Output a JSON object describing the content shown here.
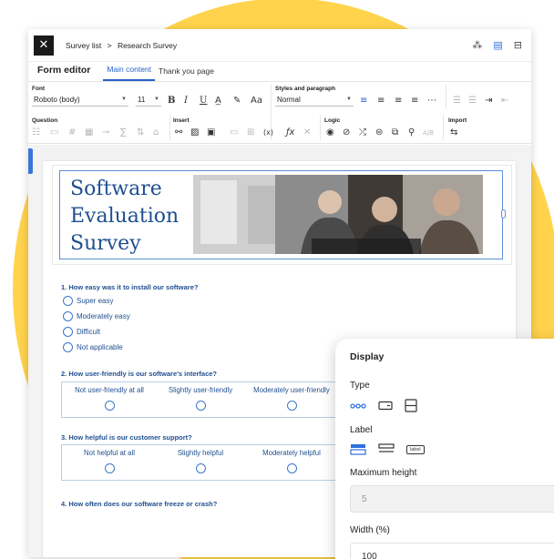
{
  "app": {
    "breadcrumb": {
      "parent": "Survey list",
      "separator": ">",
      "current": "Research Survey"
    },
    "top_icons": [
      "people-icon",
      "document-icon",
      "inbox-icon"
    ]
  },
  "tabs": {
    "title": "Form editor",
    "items": [
      "Main content",
      "Thank you page"
    ],
    "active": "Main content"
  },
  "ribbon": {
    "font_label": "Font",
    "font_value": "Roboto (body)",
    "font_size": "11",
    "case_label": "Aa",
    "styles_label": "Styles and paragraph",
    "style_value": "Normal",
    "question_label": "Question",
    "insert_label": "Insert",
    "logic_label": "Logic",
    "import_label": "Import",
    "more_label": "⋯"
  },
  "hero": {
    "title": "Software Evaluation Survey"
  },
  "questions": [
    {
      "title": "1. How easy was it to install our software?",
      "options": [
        "Super easy",
        "Moderately easy",
        "Difficult",
        "Not applicable"
      ]
    },
    {
      "title": "2. How user-friendly is our software's interface?",
      "scale": [
        "Not user-friendly at all",
        "Slightly user-friendly",
        "Moderately user-friendly"
      ]
    },
    {
      "title": "3. How helpful is our customer support?",
      "scale": [
        "Not helpful  at all",
        "Slightly helpful",
        "Moderately helpful"
      ]
    },
    {
      "title": "4. How often does our software freeze or crash?"
    }
  ],
  "display_panel": {
    "heading": "Display",
    "type_label": "Type",
    "label_label": "Label",
    "label_badge": "label",
    "max_height_label": "Maximum height",
    "max_height_value": "5",
    "width_label": "Width (%)",
    "width_value": "100"
  },
  "colors": {
    "accent": "#2563c9",
    "question": "#1f4f8f",
    "background_circle": "#ffd34c"
  }
}
